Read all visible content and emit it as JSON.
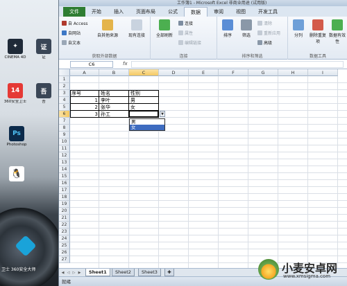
{
  "desktop": {
    "icons": [
      {
        "label": "CINEMA 4D",
        "color": "#1f2a38",
        "glyph": "✦"
      },
      {
        "label": "证",
        "color": "#3a4656",
        "glyph": "证"
      },
      {
        "label": "360安全卫士",
        "color": "#e53935",
        "glyph": "14"
      },
      {
        "label": "吾",
        "color": "#3a4656",
        "glyph": "吾"
      },
      {
        "label": "Photoshop",
        "color": "#0b2a4a",
        "glyph": "Ps"
      },
      {
        "label": "",
        "color": "#ffffff",
        "glyph": "🐧"
      }
    ],
    "caption": "卫士 360安全大师"
  },
  "excel": {
    "title": "工作簿1 - Microsoft Excel 非商业用途 (试用版)",
    "tabs": [
      "文件",
      "开始",
      "插入",
      "页面布局",
      "公式",
      "数据",
      "审阅",
      "视图",
      "开发工具"
    ],
    "active_tab": "数据",
    "ribbon": {
      "get_external": {
        "name": "获取外部数据",
        "access": "自 Access",
        "web": "自网站",
        "text": "自文本",
        "other": "自其他来源",
        "existing": "现有连接"
      },
      "connections": {
        "name": "连接",
        "refresh": "全部刷新",
        "connect": "连接",
        "props": "属性",
        "edit_links": "编辑链接"
      },
      "sort_filter": {
        "name": "排序和筛选",
        "sort": "排序",
        "filter": "筛选",
        "clear": "清除",
        "reapply": "重新应用",
        "advanced": "高级"
      },
      "data_tools": {
        "name": "数据工具",
        "split": "分列",
        "remove_dup": "删除重复项",
        "validation": "数据有效性"
      }
    },
    "name_box": "C6",
    "fx": "fx",
    "columns": [
      "A",
      "B",
      "C",
      "D",
      "E",
      "F",
      "G",
      "H",
      "I"
    ],
    "selected_column": "C",
    "rows": [
      "1",
      "2",
      "3",
      "4",
      "5",
      "6",
      "7",
      "8",
      "9",
      "10",
      "11",
      "12",
      "13",
      "14",
      "15",
      "16",
      "17",
      "18",
      "19",
      "20",
      "21",
      "22",
      "23",
      "24",
      "25",
      "26",
      "27"
    ],
    "selected_row": "6",
    "cells": {
      "A3": "序号",
      "B3": "姓名",
      "C3": "性别",
      "A4": "1",
      "B4": "李叶",
      "C4": "男",
      "A5": "2",
      "B5": "张华",
      "C5": "女",
      "A6": "3",
      "B6": "孙工"
    },
    "dropdown_options": [
      "男",
      "女"
    ],
    "dropdown_highlight": "女",
    "sheets": [
      "Sheet1",
      "Sheet2",
      "Sheet3"
    ],
    "active_sheet": "Sheet1",
    "status": "就绪"
  },
  "watermark": {
    "title": "小麦安卓网",
    "url": "www.xmsigma.com"
  }
}
